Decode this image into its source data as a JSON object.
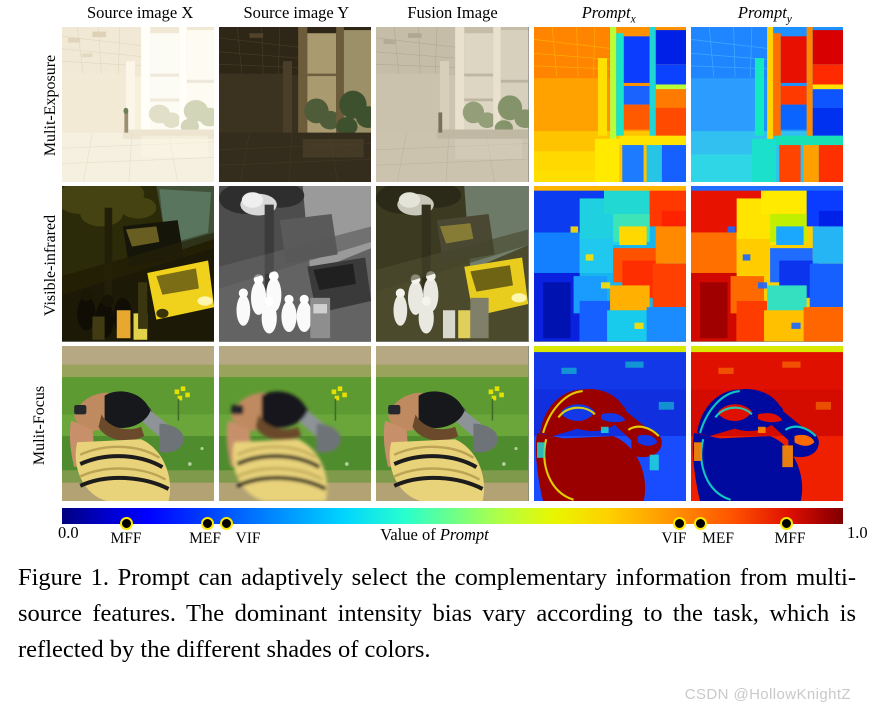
{
  "figure": {
    "column_headers": [
      {
        "text": "Source image X",
        "italic": false
      },
      {
        "text": "Source image Y",
        "italic": false
      },
      {
        "text": "Fusion Image",
        "italic": false
      },
      {
        "text": "Prompt",
        "subscript": "x",
        "italic": true
      },
      {
        "text": "Prompt",
        "subscript": "y",
        "italic": true
      }
    ],
    "row_labels": [
      "Mulit-Exposure",
      "Visible-infrared",
      "Mulit-Focus"
    ],
    "rows": [
      {
        "task": "Mulit-Exposure",
        "cells": [
          {
            "kind": "photo",
            "scene": "overexposed-office-interior-with-windows"
          },
          {
            "kind": "photo",
            "scene": "underexposed-office-interior-with-windows"
          },
          {
            "kind": "photo",
            "scene": "fused-office-interior-with-windows"
          },
          {
            "kind": "heatmap",
            "dominant": "warm",
            "scene": "prompt-x-office"
          },
          {
            "kind": "heatmap",
            "dominant": "cool",
            "scene": "prompt-y-office"
          }
        ]
      },
      {
        "task": "Visible-infrared",
        "cells": [
          {
            "kind": "photo",
            "scene": "night-street-yellow-car-pedestrians-visible"
          },
          {
            "kind": "photo",
            "scene": "infrared-thermal-street-pedestrians"
          },
          {
            "kind": "photo",
            "scene": "fused-night-street-scene"
          },
          {
            "kind": "heatmap",
            "dominant": "cool",
            "scene": "prompt-x-street"
          },
          {
            "kind": "heatmap",
            "dominant": "warm",
            "scene": "prompt-y-street"
          }
        ]
      },
      {
        "task": "Mulit-Focus",
        "cells": [
          {
            "kind": "photo",
            "scene": "golfer-foreground-focus"
          },
          {
            "kind": "photo",
            "scene": "golfer-background-focus"
          },
          {
            "kind": "photo",
            "scene": "golfer-all-in-focus-fused"
          },
          {
            "kind": "heatmap",
            "dominant": "binary-warm-subject",
            "scene": "prompt-x-golfer"
          },
          {
            "kind": "heatmap",
            "dominant": "binary-cool-subject",
            "scene": "prompt-y-golfer"
          }
        ]
      }
    ]
  },
  "colorbar": {
    "min_label": "0.0",
    "max_label": "1.0",
    "center_label_prefix": "Value of ",
    "center_label_italic": "Prompt",
    "colormap": "jet",
    "markers": [
      {
        "label": "MFF",
        "value": 0.082,
        "side": "left"
      },
      {
        "label": "MEF",
        "value": 0.186,
        "side": "left"
      },
      {
        "label": "VIF",
        "value": 0.209,
        "side": "left"
      },
      {
        "label": "VIF",
        "value": 0.79,
        "side": "right"
      },
      {
        "label": "MEF",
        "value": 0.817,
        "side": "right"
      },
      {
        "label": "MFF",
        "value": 0.926,
        "side": "right"
      }
    ]
  },
  "caption": {
    "text": "Figure 1. Prompt can adaptively select the complementary information from multi-source features. The dominant intensity bias vary according to the task, which is reflected by the different shades of colors."
  },
  "watermark": {
    "text": "CSDN @HollowKnightZ"
  },
  "chart_data": {
    "type": "heatmap",
    "title": "Prompt can adaptively select the complementary information from multi-source features.",
    "colormap": "jet",
    "colorbar_label": "Value of Prompt",
    "colorbar_range": [
      0.0,
      1.0
    ],
    "categories": [
      "Mulit-Exposure",
      "Visible-infrared",
      "Mulit-Focus"
    ],
    "columns": [
      "Source image X",
      "Source image Y",
      "Fusion Image",
      "Prompt_x",
      "Prompt_y"
    ],
    "series": [
      {
        "name": "Prompt_x",
        "categories": [
          "MFF",
          "MEF",
          "VIF"
        ],
        "values": [
          0.082,
          0.186,
          0.209
        ]
      },
      {
        "name": "Prompt_y",
        "categories": [
          "VIF",
          "MEF",
          "MFF"
        ],
        "values": [
          0.79,
          0.817,
          0.926
        ]
      }
    ],
    "annotations": [
      "MFF low prompt value 0.08 / high 0.93",
      "MEF low prompt value 0.19 / high 0.82",
      "VIF low prompt value 0.21 / high 0.79"
    ],
    "xlabel": "Value of Prompt",
    "ylabel": "",
    "xlim": [
      0.0,
      1.0
    ],
    "grid": false,
    "legend_position": "bottom"
  }
}
